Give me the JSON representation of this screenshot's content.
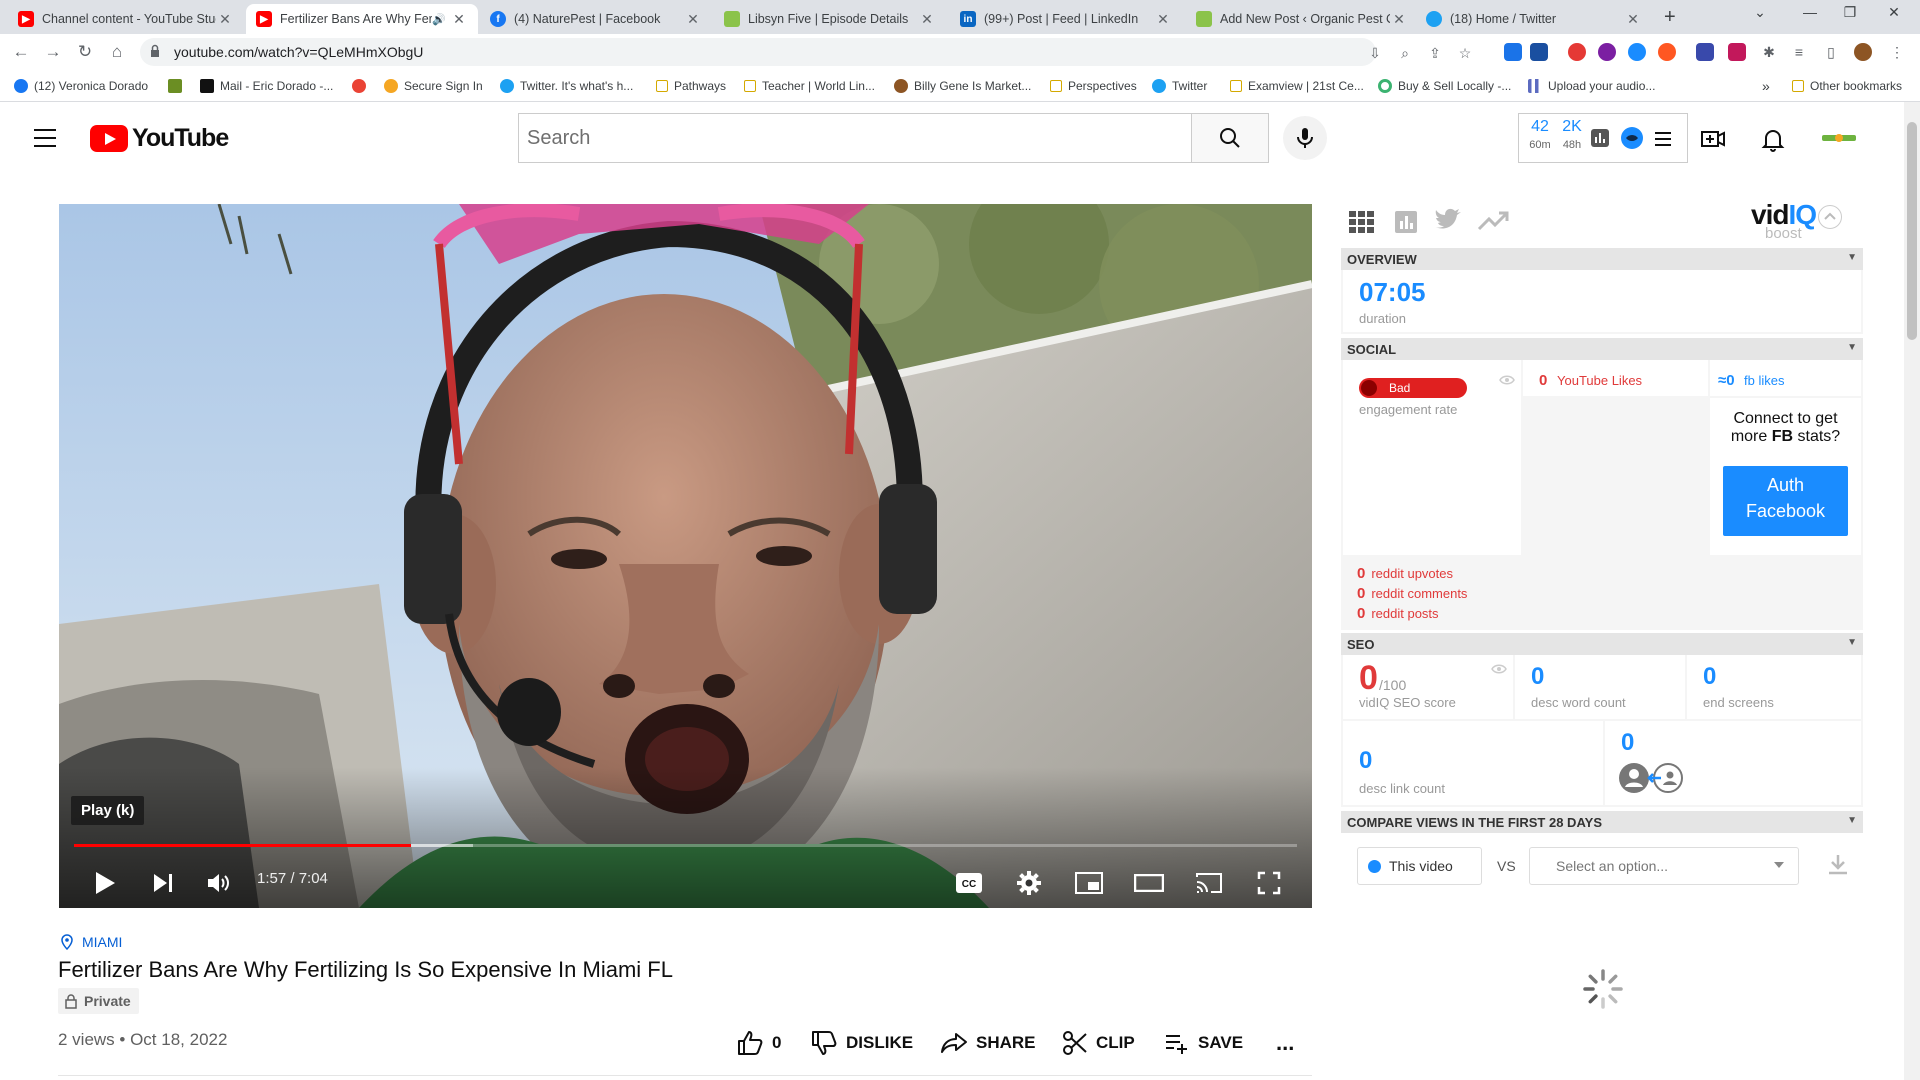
{
  "browser": {
    "tabs": [
      {
        "title": "Channel content - YouTube Studio",
        "favicon": "youtube-icon",
        "color": "#ff0000",
        "active": false
      },
      {
        "title": "Fertilizer Bans Are Why Fertilizing",
        "favicon": "youtube-icon",
        "color": "#ff0000",
        "active": true,
        "audio": true
      },
      {
        "title": "(4) NaturePest | Facebook",
        "favicon": "facebook-icon",
        "color": "#1877f2",
        "active": false
      },
      {
        "title": "Libsyn Five | Episode Details",
        "favicon": "libsyn-icon",
        "color": "#8bc34a",
        "active": false
      },
      {
        "title": "(99+) Post | Feed | LinkedIn",
        "favicon": "linkedin-icon",
        "color": "#0a66c2",
        "active": false
      },
      {
        "title": "Add New Post ‹ Organic Pest Co",
        "favicon": "wordpress-icon",
        "color": "#8bc34a",
        "active": false
      },
      {
        "title": "(18) Home / Twitter",
        "favicon": "twitter-icon",
        "color": "#1da1f2",
        "active": false
      }
    ],
    "new_tab": "+",
    "window_controls": [
      "⌄",
      "—",
      "❐",
      "✕"
    ],
    "url": "youtube.com/watch?v=QLeMHmXObgU",
    "bookmarks": [
      {
        "label": "(12) Veronica Dorado",
        "icon": "facebook-icon",
        "color": "#1877f2"
      },
      {
        "label": "",
        "icon": "leaf-icon",
        "color": "#6b8e23"
      },
      {
        "label": "Mail - Eric Dorado -...",
        "icon": "mail-icon",
        "color": "#111111"
      },
      {
        "label": "",
        "icon": "pinwheel-icon",
        "color": "#ea4335"
      },
      {
        "label": "Secure Sign In",
        "icon": "sun-icon",
        "color": "#f5a623"
      },
      {
        "label": "Twitter. It's what's h...",
        "icon": "twitter-icon",
        "color": "#1da1f2"
      },
      {
        "label": "Pathways",
        "icon": "folder-icon",
        "color": "#d4a900"
      },
      {
        "label": "Teacher | World Lin...",
        "icon": "folder-icon",
        "color": "#d4a900"
      },
      {
        "label": "Billy Gene Is Market...",
        "icon": "face-icon",
        "color": "#8d5524"
      },
      {
        "label": "Perspectives",
        "icon": "folder-icon",
        "color": "#d4a900"
      },
      {
        "label": "Twitter",
        "icon": "twitter-icon",
        "color": "#1da1f2"
      },
      {
        "label": "Examview | 21st Ce...",
        "icon": "folder-icon",
        "color": "#d4a900"
      },
      {
        "label": "Buy & Sell Locally -...",
        "icon": "ring-icon",
        "color": "#3cb371"
      },
      {
        "label": "Upload your audio...",
        "icon": "bars-icon",
        "color": "#5c6bc0"
      }
    ],
    "more_bookmarks": "»",
    "other_bookmarks": "Other bookmarks"
  },
  "youtube": {
    "logo_text": "YouTube",
    "search_placeholder": "Search",
    "vidiq_header": {
      "stat1_value": "42",
      "stat1_label": "60m",
      "stat2_value": "2K",
      "stat2_label": "48h"
    }
  },
  "video": {
    "tooltip": "Play (k)",
    "current_time": "1:57",
    "duration": "7:04",
    "time_display": "1:57 / 7:04",
    "progress_fraction": 0.2759,
    "buffered_fraction": 0.3266,
    "location": "MIAMI",
    "title": "Fertilizer Bans Are Why Fertilizing Is So Expensive In Miami FL",
    "privacy": "Private",
    "meta": "2 views • Oct 18, 2022",
    "actions": {
      "likes": "0",
      "dislike": "DISLIKE",
      "share": "SHARE",
      "clip": "CLIP",
      "save": "SAVE",
      "more": "..."
    }
  },
  "vidiq": {
    "logo_main": "vid",
    "logo_accent": "IQ",
    "logo_sub": "boost",
    "overview": {
      "header": "OVERVIEW",
      "duration_value": "07:05",
      "duration_label": "duration"
    },
    "social": {
      "header": "SOCIAL",
      "engagement_badge": "Bad",
      "engagement_label": "engagement rate",
      "youtube_likes_value": "0",
      "youtube_likes_label": "YouTube Likes",
      "fb_likes_value": "≈0",
      "fb_likes_label": "fb likes",
      "connect_text_1": "Connect to get",
      "connect_text_2": "more",
      "connect_text_bold": "FB",
      "connect_text_3": "stats?",
      "auth_button_line1": "Auth",
      "auth_button_line2": "Facebook",
      "reddit": [
        {
          "value": "0",
          "label": "reddit upvotes"
        },
        {
          "value": "0",
          "label": "reddit comments"
        },
        {
          "value": "0",
          "label": "reddit posts"
        }
      ]
    },
    "seo": {
      "header": "SEO",
      "score_value": "0",
      "score_max": "/100",
      "score_label": "vidIQ SEO score",
      "desc_word_count_value": "0",
      "desc_word_count_label": "desc word count",
      "end_screens_value": "0",
      "end_screens_label": "end screens",
      "desc_link_count_value": "0",
      "desc_link_count_label": "desc link count",
      "subscribe_value": "0"
    },
    "compare": {
      "header": "COMPARE VIEWS IN THE FIRST 28 DAYS",
      "this_video": "This video",
      "vs": "VS",
      "select_placeholder": "Select an option..."
    },
    "colors": {
      "blue": "#1a8cff",
      "red": "#e03a3a",
      "bad": "#e02020"
    }
  }
}
